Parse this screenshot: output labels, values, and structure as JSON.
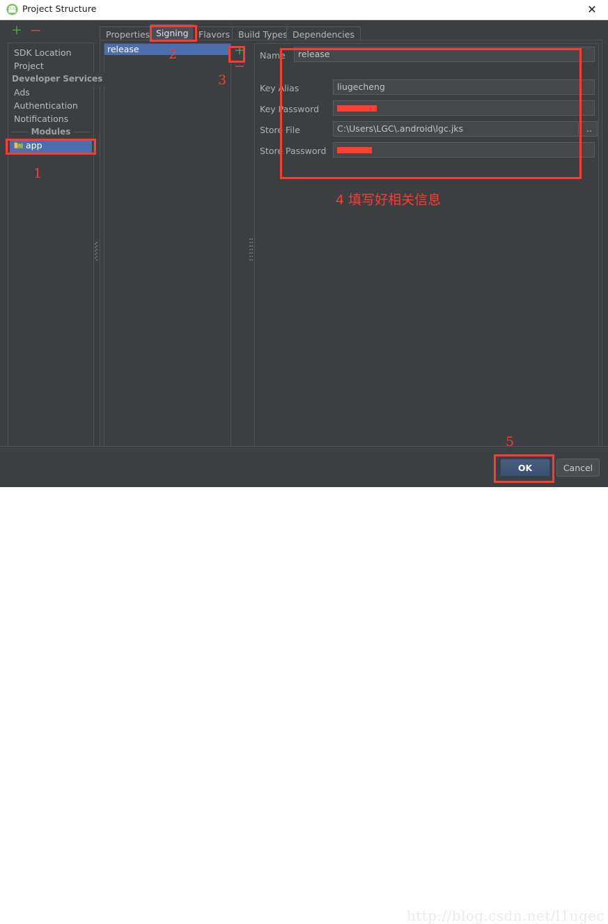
{
  "window": {
    "title": "Project Structure",
    "icon": "android-robot-icon",
    "close_label": "✕"
  },
  "toolbar": {
    "add_label": "+",
    "remove_label": "−"
  },
  "sidebar": {
    "items": [
      {
        "label": "SDK Location",
        "type": "item",
        "name": "sidebar-item-sdk-location"
      },
      {
        "label": "Project",
        "type": "item",
        "name": "sidebar-item-project"
      },
      {
        "label": "Developer Services",
        "type": "separator",
        "name": "sidebar-separator-developer-services"
      },
      {
        "label": "Ads",
        "type": "item",
        "name": "sidebar-item-ads"
      },
      {
        "label": "Authentication",
        "type": "item",
        "name": "sidebar-item-authentication"
      },
      {
        "label": "Notifications",
        "type": "item",
        "name": "sidebar-item-notifications"
      },
      {
        "label": "Modules",
        "type": "separator",
        "name": "sidebar-separator-modules"
      },
      {
        "label": "app",
        "type": "module",
        "selected": true,
        "name": "sidebar-item-app"
      }
    ]
  },
  "tabs": [
    {
      "label": "Properties",
      "active": false
    },
    {
      "label": "Signing",
      "active": true
    },
    {
      "label": "Flavors",
      "active": false
    },
    {
      "label": "Build Types",
      "active": false
    },
    {
      "label": "Dependencies",
      "active": false
    }
  ],
  "signing": {
    "configs": [
      {
        "label": "release",
        "selected": true
      }
    ],
    "add_label": "+",
    "remove_label": "−",
    "fields": [
      {
        "label": "Name",
        "value": "release",
        "redacted": false,
        "browse": false
      },
      {
        "label": "Key Alias",
        "value": "liugecheng",
        "redacted": false,
        "browse": false
      },
      {
        "label": "Key Password",
        "value": "",
        "redacted": true,
        "redact_width": 57,
        "browse": false
      },
      {
        "label": "Store File",
        "value": "C:\\Users\\LGC\\.android\\lgc.jks",
        "redacted": false,
        "browse": true,
        "browse_label": ".."
      },
      {
        "label": "Store Password",
        "value": "",
        "redacted": true,
        "redact_width": 50,
        "browse": false
      }
    ]
  },
  "buttons": {
    "ok": "OK",
    "cancel": "Cancel"
  },
  "watermark": "http://blog.csdn.net/l1ugec",
  "annotations": {
    "n1": "1",
    "n2": "2",
    "n3": "3",
    "n4": "4 填写好相关信息",
    "n5": "5",
    "color": "#fd3b30"
  }
}
